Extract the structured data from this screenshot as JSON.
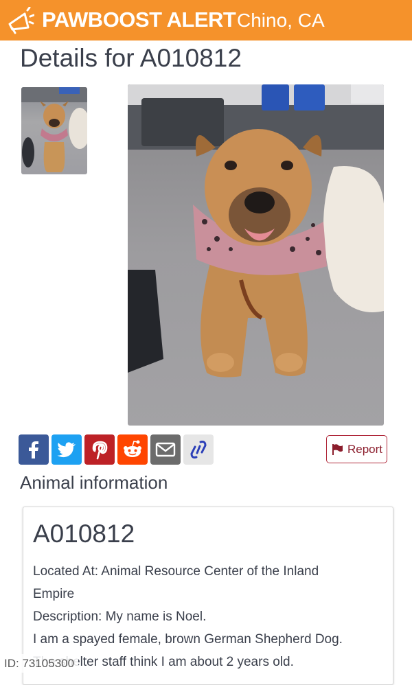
{
  "header": {
    "brand": "PAWBOOST ALERT",
    "city": "Chino, CA",
    "color": "#f5922b"
  },
  "page_title": "Details for A010812",
  "share": {
    "facebook_color": "#3b5998",
    "twitter_color": "#1da1f2",
    "pinterest_color": "#bd2126",
    "reddit_color": "#ff4500",
    "email_color": "#6c6c6c",
    "copy_link_color": "#e6e6e6"
  },
  "report": {
    "label": "Report",
    "color": "#b0283a"
  },
  "section": {
    "title": "Animal information"
  },
  "card": {
    "id": "A010812",
    "lines": [
      "Located At: Animal Resource Center of the Inland",
      "Empire",
      "Description: My name is Noel.",
      "I am a spayed female, brown German Shepherd Dog.",
      "The shelter staff think I am about 2 years old."
    ]
  },
  "footer": {
    "id_tag": "ID: 73105300"
  }
}
